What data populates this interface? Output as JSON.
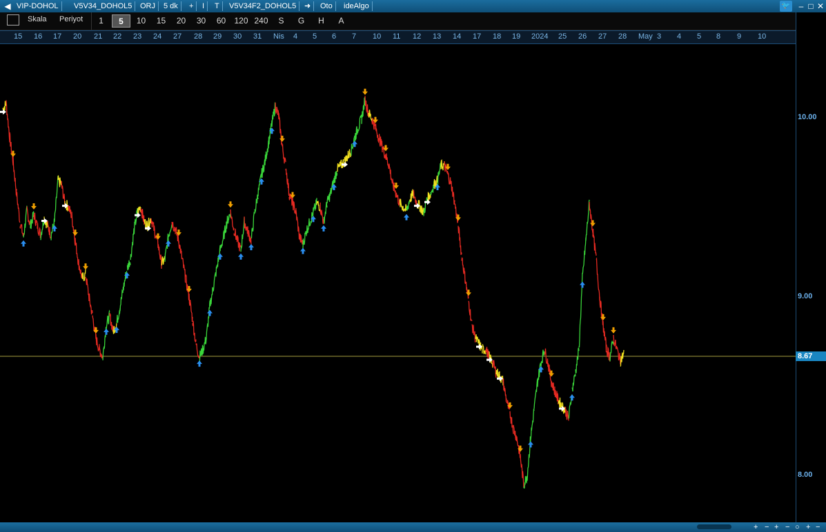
{
  "titlebar": {
    "symbol": "VIP-DOHOL",
    "strategy": "V5V34_DOHOL5",
    "mode": "ORJ",
    "interval": "5 dk",
    "plus": "+",
    "cursor": "I",
    "template_icon": "T",
    "strategy2": "V5V34F2_DOHOL5",
    "arrow": "➜",
    "auto": "Oto",
    "platform": "ideAlgo"
  },
  "toolbar": {
    "scale_label": "Skala",
    "period_label": "Periyot",
    "periods": [
      "1",
      "5",
      "10",
      "15",
      "20",
      "30",
      "60",
      "120",
      "240",
      "S",
      "G",
      "H",
      "A"
    ],
    "active_period": "5"
  },
  "dates": [
    "15",
    "16",
    "17",
    "20",
    "21",
    "22",
    "23",
    "24",
    "27",
    "28",
    "29",
    "30",
    "31",
    "Nis",
    "4",
    "5",
    "6",
    "7",
    "10",
    "11",
    "12",
    "13",
    "14",
    "17",
    "18",
    "19",
    "2024",
    "25",
    "26",
    "27",
    "28",
    "May",
    "3",
    "4",
    "5",
    "8",
    "9",
    "10"
  ],
  "price_axis": {
    "labels": [
      "10.00",
      "9.00",
      "8.00"
    ],
    "current": "8.67"
  },
  "bottombar": {
    "controls": [
      "+",
      "−",
      "+",
      "−",
      "○",
      "+",
      "−"
    ]
  },
  "chart_data": {
    "type": "line",
    "ylim": [
      7.8,
      10.35
    ],
    "current_price": 8.67,
    "x": [
      0,
      5,
      10,
      15,
      20,
      25,
      30,
      35,
      40,
      45,
      50,
      55,
      60,
      65,
      70,
      75,
      80,
      85,
      90,
      95,
      100,
      105,
      110,
      115,
      120,
      125,
      130,
      135,
      140,
      145,
      150,
      155,
      160,
      165,
      170,
      175,
      180,
      185,
      190,
      195,
      200,
      205,
      210,
      215,
      220,
      225,
      230,
      235,
      240,
      245,
      250,
      255,
      260,
      265,
      270,
      275,
      280,
      285,
      290,
      295,
      300,
      305,
      310,
      315,
      320,
      325,
      330,
      335,
      340,
      345,
      350,
      355,
      360,
      365,
      370,
      375,
      380,
      385,
      390,
      395,
      400,
      405,
      410,
      415,
      420,
      425,
      430,
      435,
      440,
      445,
      450,
      455,
      460,
      465,
      470,
      475,
      480,
      485,
      490,
      495,
      500,
      505,
      510,
      515,
      520,
      525,
      530,
      535,
      540,
      545,
      550,
      555,
      560,
      565,
      570,
      575,
      580,
      585,
      590,
      595,
      600,
      605,
      610,
      615,
      620,
      625,
      630,
      635,
      640,
      645,
      650,
      655,
      660,
      665,
      670,
      675,
      680,
      685,
      690,
      695,
      700,
      705,
      710,
      715,
      720,
      725,
      730,
      735,
      740,
      745,
      750,
      755,
      760,
      765,
      770,
      775,
      780,
      785,
      790,
      795,
      800,
      805,
      810,
      815,
      820,
      825,
      830,
      835,
      840,
      845,
      850,
      855,
      860,
      865,
      870,
      875,
      880,
      885,
      890,
      895,
      900,
      905,
      910,
      915,
      920,
      925,
      930,
      935,
      940,
      945,
      950,
      955,
      960,
      965,
      970,
      975,
      980,
      985,
      990,
      995,
      1000,
      1005,
      1010,
      1015,
      1020,
      1025,
      1030,
      1035,
      1040,
      1045,
      1050,
      1055,
      1060,
      1065,
      1070,
      1075,
      1080,
      1085,
      1090,
      1095,
      1100,
      1105,
      1110,
      1115,
      1120
    ],
    "values": [
      10.0,
      10.03,
      9.85,
      9.72,
      9.55,
      9.4,
      9.32,
      9.46,
      9.38,
      9.44,
      9.38,
      9.33,
      9.42,
      9.38,
      9.33,
      9.4,
      9.62,
      9.6,
      9.5,
      9.48,
      9.43,
      9.3,
      9.18,
      9.1,
      9.12,
      9.0,
      8.9,
      8.78,
      8.72,
      8.68,
      8.85,
      8.9,
      8.82,
      8.86,
      8.95,
      9.05,
      9.15,
      9.2,
      9.35,
      9.45,
      9.48,
      9.4,
      9.38,
      9.42,
      9.35,
      9.28,
      9.18,
      9.2,
      9.32,
      9.4,
      9.36,
      9.3,
      9.2,
      9.1,
      9.0,
      8.88,
      8.75,
      8.68,
      8.72,
      8.78,
      8.95,
      9.05,
      9.15,
      9.25,
      9.32,
      9.4,
      9.45,
      9.36,
      9.3,
      9.25,
      9.4,
      9.35,
      9.3,
      9.45,
      9.55,
      9.65,
      9.72,
      9.82,
      9.92,
      10.02,
      9.96,
      9.8,
      9.7,
      9.55,
      9.5,
      9.45,
      9.32,
      9.28,
      9.35,
      9.4,
      9.45,
      9.5,
      9.48,
      9.4,
      9.5,
      9.55,
      9.62,
      9.68,
      9.7,
      9.72,
      9.75,
      9.78,
      9.85,
      9.9,
      9.95,
      10.05,
      9.98,
      9.95,
      9.9,
      9.85,
      9.8,
      9.75,
      9.7,
      9.6,
      9.55,
      9.5,
      9.48,
      9.46,
      9.52,
      9.55,
      9.5,
      9.48,
      9.45,
      9.52,
      9.55,
      9.6,
      9.62,
      9.7,
      9.7,
      9.65,
      9.6,
      9.5,
      9.38,
      9.22,
      9.1,
      8.98,
      8.85,
      8.78,
      8.75,
      8.72,
      8.72,
      8.68,
      8.65,
      8.6,
      8.58,
      8.55,
      8.45,
      8.38,
      8.3,
      8.25,
      8.15,
      8.0,
      8.05,
      8.25,
      8.4,
      8.55,
      8.65,
      8.72,
      8.65,
      8.55,
      8.5,
      8.45,
      8.42,
      8.4,
      8.35,
      8.5,
      8.6,
      8.72,
      9.1,
      9.3,
      9.5,
      9.35,
      9.2,
      9.0,
      8.85,
      8.72,
      8.68,
      8.78,
      8.72,
      8.66,
      8.7
    ]
  }
}
